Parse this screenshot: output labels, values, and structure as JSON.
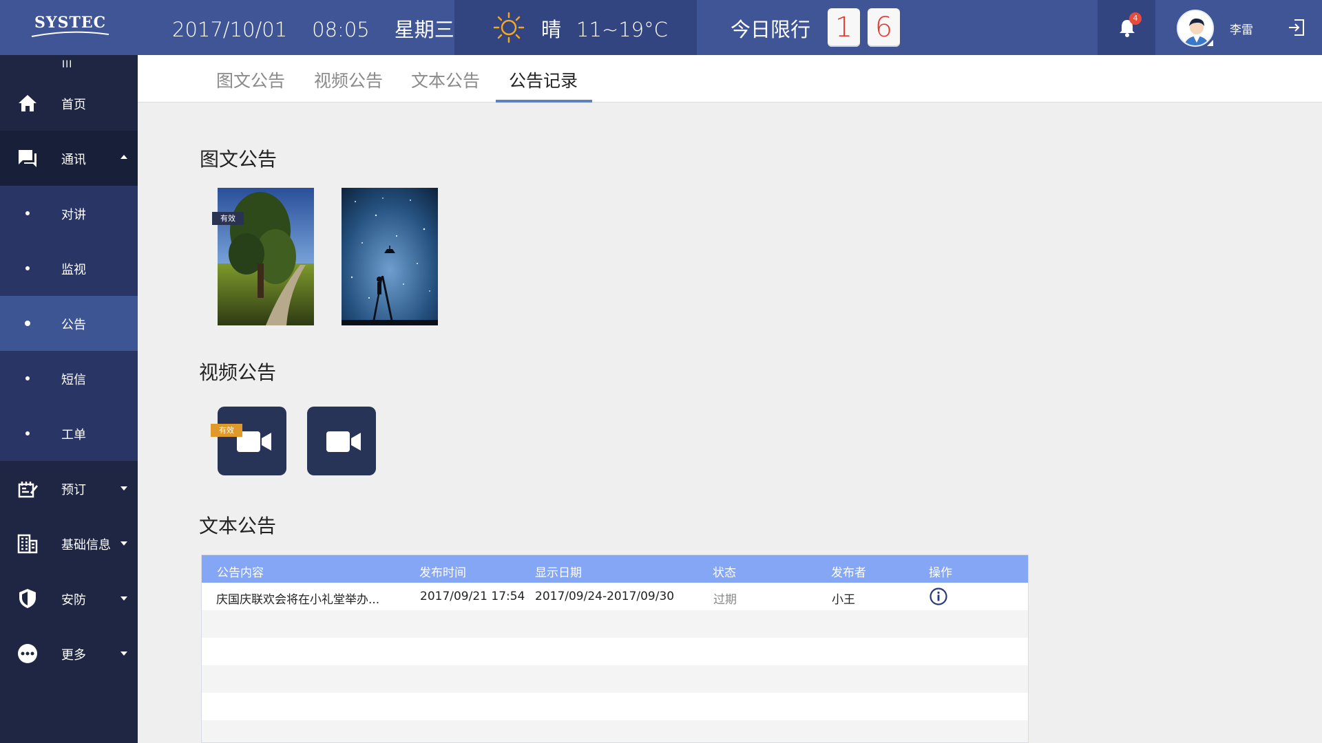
{
  "header": {
    "logo_text": "SYSTEC",
    "date": "2017/10/01",
    "time": "08:05",
    "weekday": "星期三",
    "weather": {
      "icon": "sun-icon",
      "condition": "晴",
      "temperature": "11~19°C",
      "accent": "#f5a623"
    },
    "restriction_label": "今日限行",
    "restriction_digits": [
      "1",
      "6"
    ],
    "notifications": {
      "icon": "bell-icon",
      "count": "4"
    },
    "user_name": "李雷",
    "logout_icon": "logout-icon",
    "colors": {
      "bar": "#3f5596",
      "bar_dark": "#324580"
    }
  },
  "sidebar": {
    "toggle": "III",
    "items": [
      {
        "label": "首页",
        "icon": "home-icon"
      },
      {
        "label": "通讯",
        "icon": "chat-icon",
        "expanded": true
      },
      {
        "label": "预订",
        "icon": "booking-icon"
      },
      {
        "label": "基础信息",
        "icon": "building-icon"
      },
      {
        "label": "安防",
        "icon": "shield-icon"
      },
      {
        "label": "更多",
        "icon": "more-icon"
      }
    ],
    "sub_items": [
      {
        "label": "对讲"
      },
      {
        "label": "监视"
      },
      {
        "label": "公告",
        "active": true
      },
      {
        "label": "短信"
      },
      {
        "label": "工单"
      }
    ]
  },
  "tabs": [
    {
      "label": "图文公告"
    },
    {
      "label": "视频公告"
    },
    {
      "label": "文本公告"
    },
    {
      "label": "公告记录",
      "active": true
    }
  ],
  "sections": {
    "image_notice": {
      "title": "图文公告",
      "items": [
        {
          "alt": "tree-landscape-image",
          "tag": "有效",
          "tag_color": "#2b3352"
        },
        {
          "alt": "starry-sky-image"
        }
      ]
    },
    "video_notice": {
      "title": "视频公告",
      "items": [
        {
          "icon": "video-camera-icon",
          "tag": "有效",
          "tag_color": "#e09a2b"
        },
        {
          "icon": "video-camera-icon"
        }
      ]
    },
    "text_notice": {
      "title": "文本公告",
      "columns": [
        "公告内容",
        "发布时间",
        "显示日期",
        "状态",
        "发布者",
        "操作"
      ],
      "header_color": "#84a6f4",
      "rows": [
        {
          "content": "庆国庆联欢会将在小礼堂举办...",
          "publish_time": "2017/09/21  17:54",
          "display_date": "2017/09/24-2017/09/30",
          "status": "过期",
          "publisher": "小王",
          "action_icon": "info-icon"
        }
      ]
    }
  }
}
